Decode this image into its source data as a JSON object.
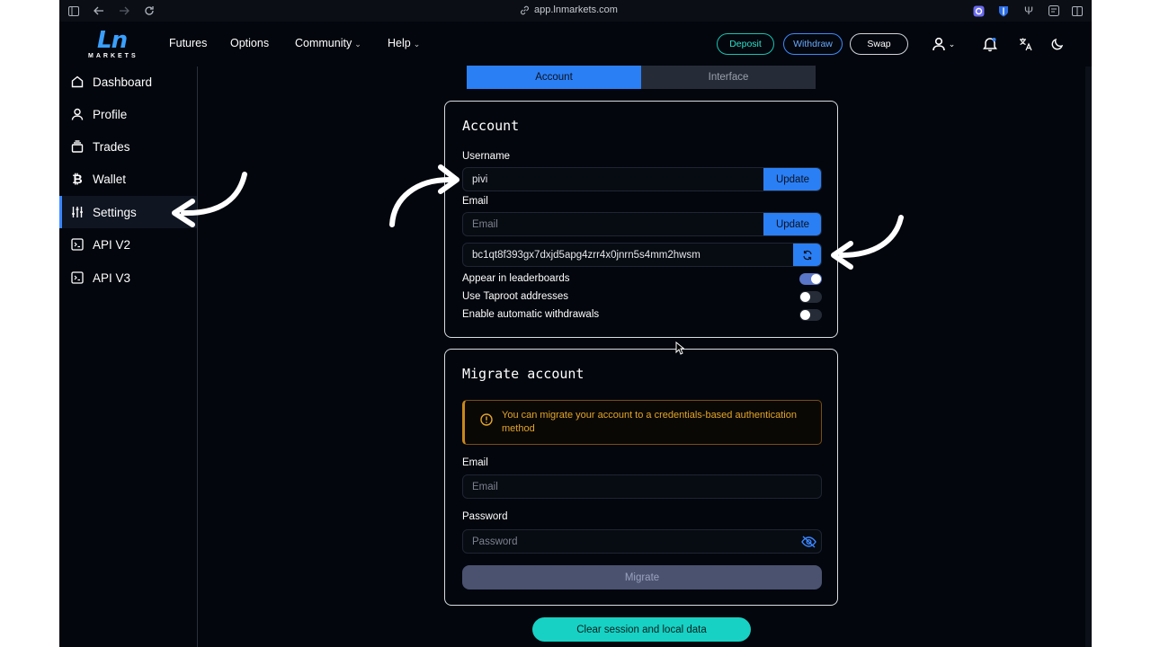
{
  "browser": {
    "url": "app.lnmarkets.com"
  },
  "brand": {
    "logo_text": "Ln",
    "logo_sub": "MARKETS",
    "accent": "#2b7ff5",
    "teal": "#17d1c4"
  },
  "nav": {
    "futures": "Futures",
    "options": "Options",
    "community": "Community",
    "help": "Help"
  },
  "header_buttons": {
    "deposit": "Deposit",
    "withdraw": "Withdraw",
    "swap": "Swap"
  },
  "sidebar": {
    "items": [
      {
        "label": "Dashboard",
        "icon": "home-icon"
      },
      {
        "label": "Profile",
        "icon": "user-icon"
      },
      {
        "label": "Trades",
        "icon": "stack-icon"
      },
      {
        "label": "Wallet",
        "icon": "bitcoin-icon"
      },
      {
        "label": "Settings",
        "icon": "sliders-icon",
        "active": true
      },
      {
        "label": "API V2",
        "icon": "terminal-icon"
      },
      {
        "label": "API V3",
        "icon": "terminal-icon"
      }
    ]
  },
  "tabs": {
    "account": "Account",
    "interface": "Interface",
    "active": "Account"
  },
  "account": {
    "title": "Account",
    "username_label": "Username",
    "username_value": "pivi",
    "update_label": "Update",
    "email_label": "Email",
    "email_placeholder": "Email",
    "btc_address": "bc1qt8f393gx7dxjd5apg4zrr4x0jnrn5s4mm2hwsm",
    "toggles": [
      {
        "label": "Appear in leaderboards",
        "on": true
      },
      {
        "label": "Use Taproot addresses",
        "on": false
      },
      {
        "label": "Enable automatic withdrawals",
        "on": false
      }
    ]
  },
  "migrate": {
    "title": "Migrate account",
    "warning": "You can migrate your account to a credentials-based authentication method",
    "email_label": "Email",
    "email_placeholder": "Email",
    "password_label": "Password",
    "password_placeholder": "Password",
    "button": "Migrate"
  },
  "clear_button": "Clear session and local data"
}
